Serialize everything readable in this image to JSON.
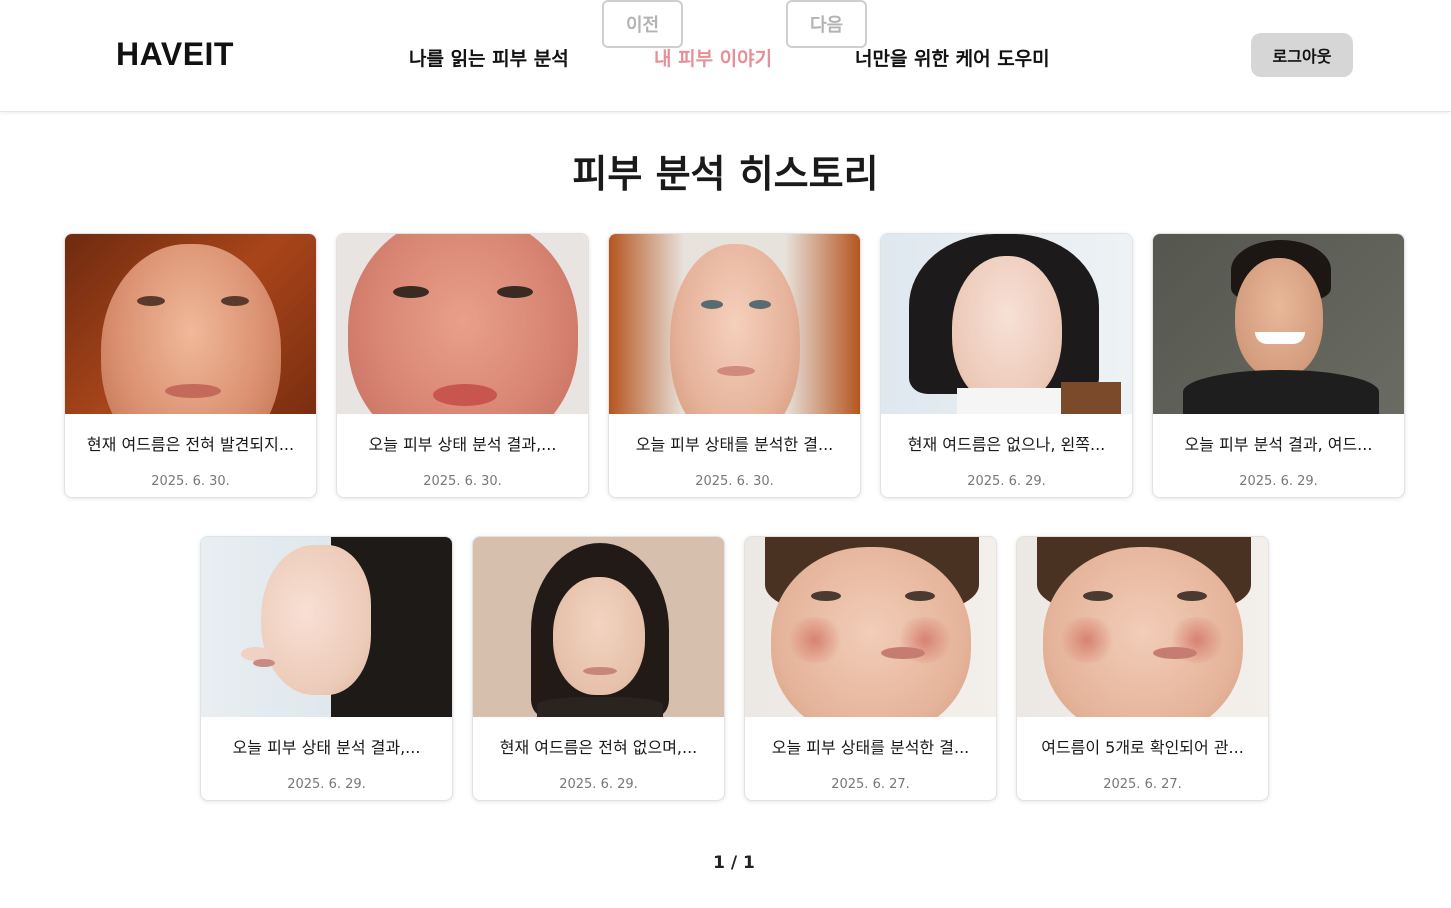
{
  "header": {
    "logo": "HAVEIT",
    "nav": [
      {
        "label": "나를 읽는 피부 분석",
        "active": false
      },
      {
        "label": "내 피부 이야기",
        "active": true
      },
      {
        "label": "너만을 위한 케어 도우미",
        "active": false
      }
    ],
    "logout_label": "로그아웃",
    "accent_color": "#e88f95"
  },
  "page": {
    "title": "피부 분석 히스토리"
  },
  "cards": [
    {
      "text": "현재 여드름은 전혀 발견되지...",
      "date": "2025. 6. 30."
    },
    {
      "text": "오늘 피부 상태 분석 결과,...",
      "date": "2025. 6. 30."
    },
    {
      "text": "오늘 피부 상태를 분석한 결...",
      "date": "2025. 6. 30."
    },
    {
      "text": "현재 여드름은 없으나, 왼쪽...",
      "date": "2025. 6. 29."
    },
    {
      "text": "오늘 피부 분석 결과, 여드...",
      "date": "2025. 6. 29."
    },
    {
      "text": "오늘 피부 상태 분석 결과,...",
      "date": "2025. 6. 29."
    },
    {
      "text": "현재 여드름은 전혀 없으며,...",
      "date": "2025. 6. 29."
    },
    {
      "text": "오늘 피부 상태를 분석한 결...",
      "date": "2025. 6. 27."
    },
    {
      "text": "여드름이 5개로 확인되어 관...",
      "date": "2025. 6. 27."
    }
  ],
  "pagination": {
    "prev_label": "이전",
    "info": "1 / 1",
    "next_label": "다음"
  }
}
